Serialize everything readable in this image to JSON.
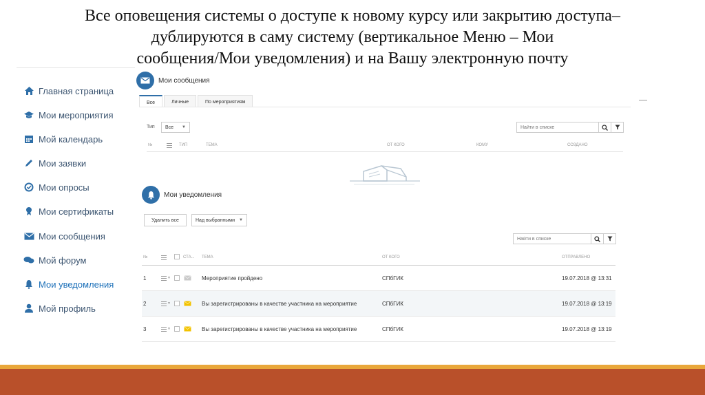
{
  "slide": {
    "title_lines": [
      "Все оповещения системы о доступе к новому курсу или закрытию доступа–",
      "дублируются в саму систему (вертикальное Меню – Мои",
      "сообщения/Мои уведомления) и на Вашу электронную почту"
    ]
  },
  "sidebar": {
    "items": [
      {
        "label": "Главная страница",
        "icon": "home-icon"
      },
      {
        "label": "Мои мероприятия",
        "icon": "graduation-cap-icon"
      },
      {
        "label": "Мой календарь",
        "icon": "calendar-icon"
      },
      {
        "label": "Мои заявки",
        "icon": "pencil-icon"
      },
      {
        "label": "Мои опросы",
        "icon": "check-circle-icon"
      },
      {
        "label": "Мои сертификаты",
        "icon": "award-icon"
      },
      {
        "label": "Мои сообщения",
        "icon": "envelope-icon"
      },
      {
        "label": "Мой форум",
        "icon": "chat-bubbles-icon"
      },
      {
        "label": "Мои уведомления",
        "icon": "bell-icon"
      },
      {
        "label": "Мой профиль",
        "icon": "user-icon"
      }
    ],
    "active_index": 8
  },
  "messages": {
    "title": "Мои сообщения",
    "tabs": [
      "Все",
      "Личные",
      "По мероприятиям"
    ],
    "active_tab": 0,
    "type_label": "Тип",
    "type_value": "Все",
    "search_placeholder": "Найти в списке",
    "columns": [
      "№",
      "Тип",
      "Тема",
      "От кого",
      "Кому",
      "Создано"
    ]
  },
  "notifications": {
    "title": "Мои уведомления",
    "delete_all_label": "Удалить все",
    "bulk_select_label": "Над выбранными",
    "search_placeholder": "Найти в списке",
    "columns": [
      "№",
      "Ста...",
      "Тема",
      "От кого",
      "Отправлено"
    ],
    "rows": [
      {
        "num": "1",
        "subject": "Мероприятие пройдено",
        "from": "СПбГИК",
        "sent": "19.07.2018 @ 13:31",
        "read": true
      },
      {
        "num": "2",
        "subject": "Вы зарегистрированы в качестве участника на мероприятие",
        "from": "СПбГИК",
        "sent": "19.07.2018 @ 13:19",
        "read": false
      },
      {
        "num": "3",
        "subject": "Вы зарегистрированы в качестве участника на мероприятие",
        "from": "СПбГИК",
        "sent": "19.07.2018 @ 13:19",
        "read": false
      }
    ]
  },
  "colors": {
    "accent": "#2f6fa8",
    "sidebar_text": "#3b5470",
    "envelope_unread": "#f2c200",
    "footer_orange": "#e9a73a",
    "footer_red": "#b9502a"
  }
}
